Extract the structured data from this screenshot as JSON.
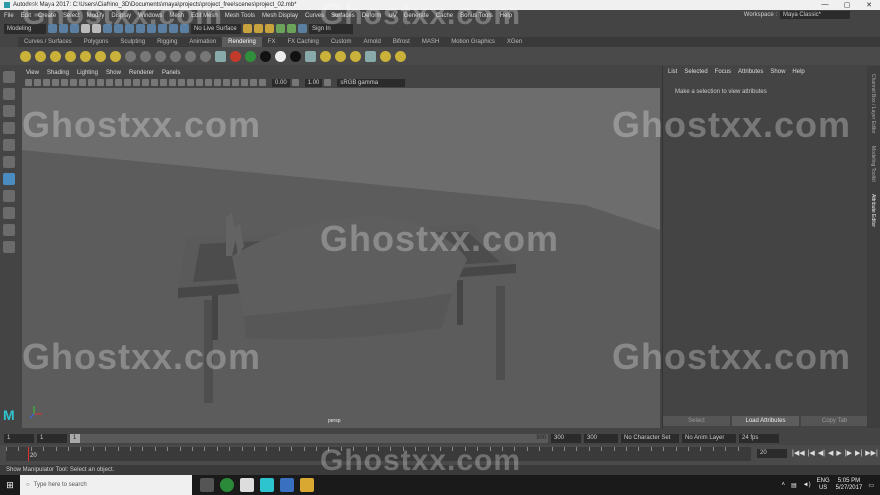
{
  "window": {
    "title": "Autodesk Maya 2017: C:\\Users\\Ciafrino_3D\\Documents\\maya\\projects\\project_free\\scenes\\project_02.mb*",
    "controls": [
      "—",
      "▢",
      "✕"
    ]
  },
  "menubar": {
    "items": [
      "File",
      "Edit",
      "Create",
      "Select",
      "Modify",
      "Display",
      "Windows",
      "Mesh",
      "Edit Mesh",
      "Mesh Tools",
      "Mesh Display",
      "Curves",
      "Surfaces",
      "Deform",
      "UV",
      "Generate",
      "Cache",
      "Bonus Tools",
      "Help"
    ],
    "workspace_label": "Workspace :",
    "workspace_value": "Maya Classic*"
  },
  "statusline": {
    "mode": "Modeling",
    "live_surface": "No Live Surface",
    "sign_in": "Sign In"
  },
  "shelf_tabs": [
    "Curves / Surfaces",
    "Polygons",
    "Sculpting",
    "Rigging",
    "Animation",
    "Rendering",
    "FX",
    "FX Caching",
    "Custom",
    "Arnold",
    "Bifrost",
    "MASH",
    "Motion Graphics",
    "XGen"
  ],
  "active_shelf_tab": "Rendering",
  "panel": {
    "menu": [
      "View",
      "Shading",
      "Lighting",
      "Show",
      "Renderer",
      "Panels"
    ],
    "exposure": "0.00",
    "gamma": "1.00",
    "color_space": "sRGB gamma",
    "camera_label": "persp"
  },
  "attribute_editor": {
    "menu": [
      "List",
      "Selected",
      "Focus",
      "Attributes",
      "Show",
      "Help"
    ],
    "message": "Make a selection to view attributes",
    "buttons": [
      "Select",
      "Load Attributes",
      "Copy Tab"
    ]
  },
  "side_tabs": [
    "Channel Box / Layer Editor",
    "Modeling Toolkit",
    "Attribute Editor"
  ],
  "range": {
    "start": "1",
    "current_start": "1",
    "slider_start": "1",
    "slider_end": "300",
    "end": "300",
    "anim_end": "300",
    "character_set": "No Character Set",
    "anim_layer": "No Anim Layer",
    "fps": "24 fps"
  },
  "timeline": {
    "current_label": "20",
    "current_field": "20",
    "play_icons": [
      "|◀◀",
      "|◀",
      "◀|",
      "◀",
      "▶",
      "|▶",
      "▶|",
      "▶▶|"
    ]
  },
  "help_line": "Show Manipulator Tool: Select an object.",
  "taskbar": {
    "search_placeholder": "Type here to search",
    "lang_top": "ENG",
    "lang_bottom": "US",
    "time": "5:05 PM",
    "date": "5/27/2017"
  },
  "watermark": "Ghostxx.com",
  "colors": {
    "accent": "#4b8cc0",
    "maya_logo": "#2ec4cf"
  }
}
